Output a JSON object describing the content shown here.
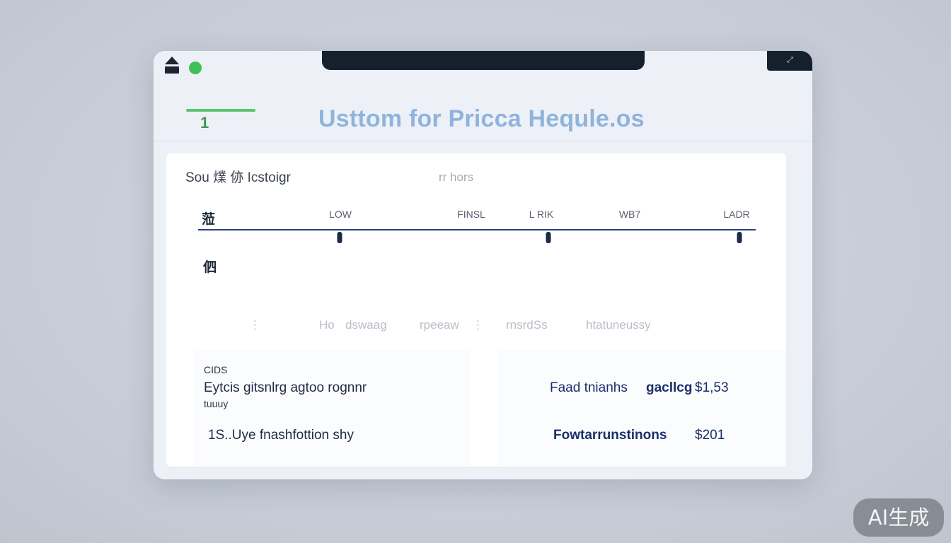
{
  "window": {
    "title": "Usttom for Pricca Hequle.os",
    "tab_marker": "1"
  },
  "panel": {
    "heading": "Sou 㸁 㑊 Icstoigr",
    "note": "rr hors",
    "row_labels": [
      "蒞",
      "伵"
    ],
    "timeline": {
      "labels": [
        "LOW",
        "FINSL",
        "L RIK",
        "WB7",
        "LADR"
      ],
      "markers": 3
    },
    "faded_items": [
      "Ho",
      "dswaag",
      "rpeeaw",
      "rnsrdSs",
      "htatuneussy"
    ]
  },
  "cards": {
    "left": {
      "tag_top": "CIDS",
      "line_main": "Eytcis   gitsnlrg agtoo rognnr",
      "tag_bottom": "tuuuy",
      "line_foot": "1S..Uye fnashfottion shy"
    },
    "right": {
      "line1_label": "Faad tnianhs",
      "line1_emph": "gacllcg",
      "line1_price": "$1,53",
      "line2_label": "Fowtarrunstinons",
      "line2_price": "$201"
    }
  },
  "badge": {
    "label": "AI生成"
  },
  "colors": {
    "accent_green": "#3fbf57",
    "timeline_navy": "#2a3f84",
    "title_blue": "#8fb4dc",
    "bar_dark": "#14202e"
  }
}
